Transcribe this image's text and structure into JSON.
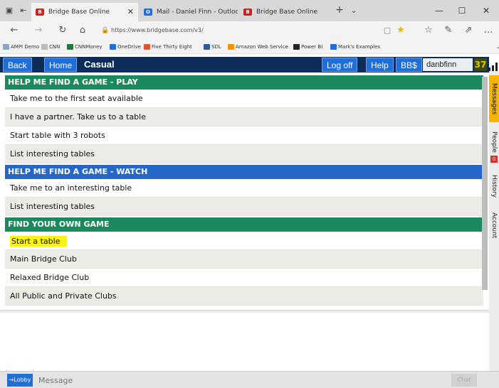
{
  "browser": {
    "tabs": [
      {
        "label": "Bridge Base Online",
        "active": true,
        "favicon": "bbo-icon"
      },
      {
        "label": "Mail - Daniel Finn - Outlook",
        "active": false,
        "favicon": "outlook-icon"
      },
      {
        "label": "Bridge Base Online",
        "active": false,
        "favicon": "bbo-icon"
      }
    ],
    "url": "https://www.bridgebase.com/v3/",
    "favorites": [
      "AMPI Demo",
      "CNN",
      "CNNMoney",
      "OneDrive",
      "Five Thirty Eight",
      "SDL",
      "Amazon Web Service",
      "Power BI",
      "Mark's Examples"
    ]
  },
  "app": {
    "nav": {
      "back": "Back",
      "home": "Home",
      "title": "Casual"
    },
    "right": {
      "logoff": "Log off",
      "help": "Help",
      "bbs": "BB$",
      "username": "danbfinn",
      "badge": "37"
    },
    "sections": [
      {
        "title": "HELP ME FIND A GAME - PLAY",
        "color": "#1a8a5e",
        "items": [
          "Take me to the first seat available",
          "I have a partner. Take us to a table",
          "Start table with 3 robots",
          "List interesting tables"
        ]
      },
      {
        "title": "HELP ME FIND A GAME - WATCH",
        "color": "#2567c9",
        "items": [
          "Take me to an interesting table",
          "List interesting tables"
        ]
      },
      {
        "title": "FIND YOUR OWN GAME",
        "color": "#1a8a5e",
        "items": [
          "Start a table",
          "Main Bridge Club",
          "Relaxed Bridge Club",
          "All Public and Private Clubs"
        ]
      }
    ],
    "side_tabs": {
      "messages": "Messages",
      "people": "People",
      "people_badge": "0",
      "history": "History",
      "account": "Account"
    },
    "chat": {
      "lobby": "→Lobby",
      "placeholder": "Message",
      "chat_button": "Chat"
    }
  }
}
